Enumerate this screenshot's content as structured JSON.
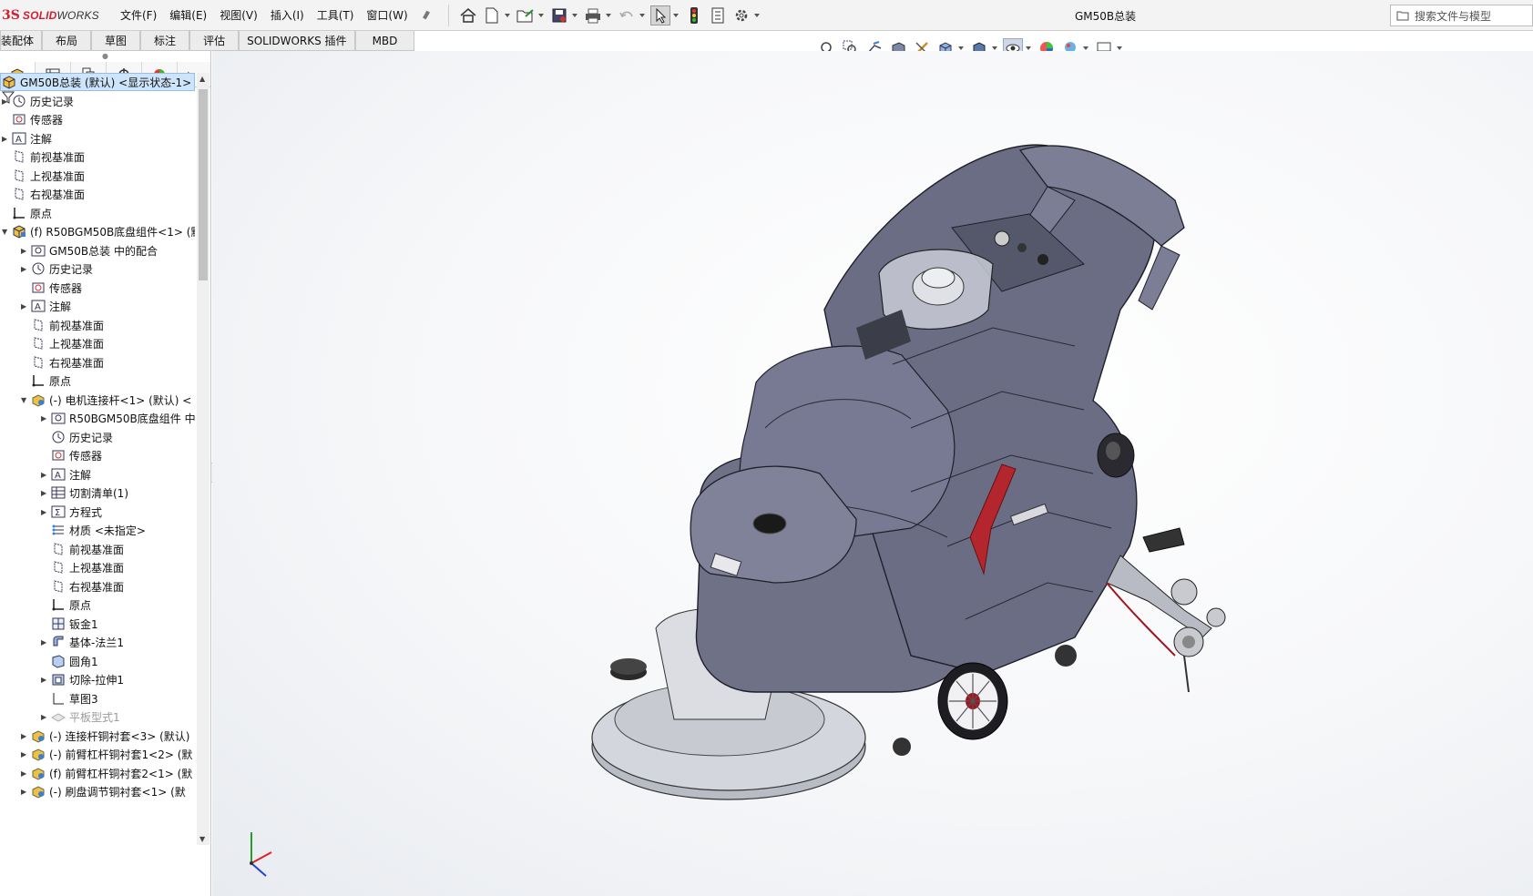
{
  "app": {
    "logo_prefix": "3S",
    "logo_solid": "SOLID",
    "logo_works": "WORKS",
    "document_title": "GM50B总装"
  },
  "menu": [
    "文件(F)",
    "编辑(E)",
    "视图(V)",
    "插入(I)",
    "工具(T)",
    "窗口(W)"
  ],
  "search": {
    "placeholder": "搜索文件与模型"
  },
  "command_tabs": [
    "装配体",
    "布局",
    "草图",
    "标注",
    "评估",
    "SOLIDWORKS 插件",
    "MBD"
  ],
  "tree": {
    "root": "GM50B总装 (默认) <显示状态-1>",
    "items": [
      {
        "label": "历史记录",
        "icon": "history-icon",
        "level": 1,
        "arrow": true
      },
      {
        "label": "传感器",
        "icon": "sensor-icon",
        "level": 1,
        "arrow": false
      },
      {
        "label": "注解",
        "icon": "annotation-icon",
        "level": 1,
        "arrow": true
      },
      {
        "label": "前视基准面",
        "icon": "plane-icon",
        "level": 1,
        "arrow": false
      },
      {
        "label": "上视基准面",
        "icon": "plane-icon",
        "level": 1,
        "arrow": false
      },
      {
        "label": "右视基准面",
        "icon": "plane-icon",
        "level": 1,
        "arrow": false
      },
      {
        "label": "原点",
        "icon": "origin-icon",
        "level": 1,
        "arrow": false
      },
      {
        "label": "(f) R50BGM50B底盘组件<1> (默",
        "icon": "assembly-icon",
        "level": 1,
        "arrow": true,
        "expanded": true
      },
      {
        "label": "GM50B总装 中的配合",
        "icon": "mates-icon",
        "level": 2,
        "arrow": true
      },
      {
        "label": "历史记录",
        "icon": "history-icon",
        "level": 2,
        "arrow": true
      },
      {
        "label": "传感器",
        "icon": "sensor-icon",
        "level": 2,
        "arrow": false
      },
      {
        "label": "注解",
        "icon": "annotation-icon",
        "level": 2,
        "arrow": true
      },
      {
        "label": "前视基准面",
        "icon": "plane-icon",
        "level": 2,
        "arrow": false
      },
      {
        "label": "上视基准面",
        "icon": "plane-icon",
        "level": 2,
        "arrow": false
      },
      {
        "label": "右视基准面",
        "icon": "plane-icon",
        "level": 2,
        "arrow": false
      },
      {
        "label": "原点",
        "icon": "origin-icon",
        "level": 2,
        "arrow": false
      },
      {
        "label": "(-) 电机连接杆<1> (默认) <",
        "icon": "part-icon",
        "level": 2,
        "arrow": true,
        "expanded": true
      },
      {
        "label": "R50BGM50B底盘组件 中",
        "icon": "mates-icon",
        "level": 3,
        "arrow": true
      },
      {
        "label": "历史记录",
        "icon": "history-icon",
        "level": 3,
        "arrow": false
      },
      {
        "label": "传感器",
        "icon": "sensor-icon",
        "level": 3,
        "arrow": false
      },
      {
        "label": "注解",
        "icon": "annotation-icon",
        "level": 3,
        "arrow": true
      },
      {
        "label": "切割清单(1)",
        "icon": "cutlist-icon",
        "level": 3,
        "arrow": true
      },
      {
        "label": "方程式",
        "icon": "equation-icon",
        "level": 3,
        "arrow": true
      },
      {
        "label": "材质 <未指定>",
        "icon": "material-icon",
        "level": 3,
        "arrow": false
      },
      {
        "label": "前视基准面",
        "icon": "plane-icon",
        "level": 3,
        "arrow": false
      },
      {
        "label": "上视基准面",
        "icon": "plane-icon",
        "level": 3,
        "arrow": false
      },
      {
        "label": "右视基准面",
        "icon": "plane-icon",
        "level": 3,
        "arrow": false
      },
      {
        "label": "原点",
        "icon": "origin-icon",
        "level": 3,
        "arrow": false
      },
      {
        "label": "钣金1",
        "icon": "sheetmetal-icon",
        "level": 3,
        "arrow": false
      },
      {
        "label": "基体-法兰1",
        "icon": "flange-icon",
        "level": 3,
        "arrow": true
      },
      {
        "label": "圆角1",
        "icon": "fillet-icon",
        "level": 3,
        "arrow": false
      },
      {
        "label": "切除-拉伸1",
        "icon": "cut-extrude-icon",
        "level": 3,
        "arrow": true
      },
      {
        "label": "草图3",
        "icon": "sketch-icon",
        "level": 3,
        "arrow": false
      },
      {
        "label": "平板型式1",
        "icon": "flat-pattern-icon",
        "level": 3,
        "arrow": true,
        "dim": true
      },
      {
        "label": "(-) 连接杆铜衬套<3> (默认)",
        "icon": "part-icon",
        "level": 2,
        "arrow": true
      },
      {
        "label": "(-) 前臂杠杆铜衬套1<2> (默",
        "icon": "part-icon",
        "level": 2,
        "arrow": true
      },
      {
        "label": "(f) 前臂杠杆铜衬套2<1> (默",
        "icon": "part-icon",
        "level": 2,
        "arrow": true
      },
      {
        "label": "(-) 刷盘调节铜衬套<1> (默",
        "icon": "part-icon",
        "level": 2,
        "arrow": true
      }
    ]
  },
  "colors": {
    "accent_red": "#d1202e",
    "body_gray": "#6f7187",
    "selection": "#cde4fa"
  }
}
